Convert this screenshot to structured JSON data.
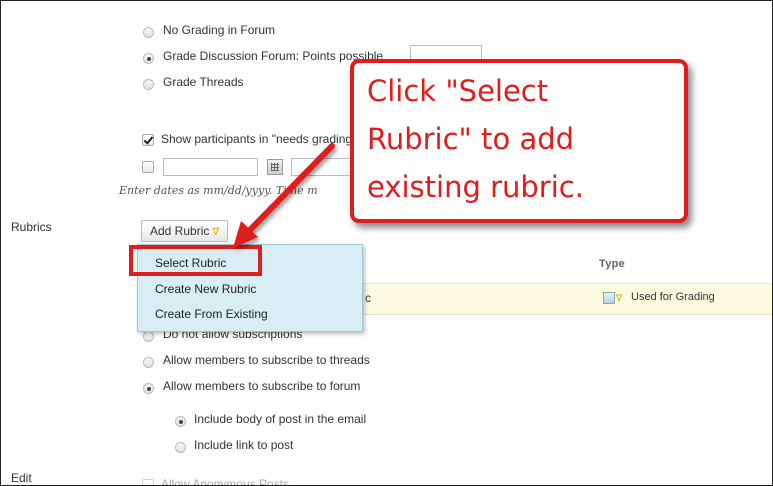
{
  "grading": {
    "options": [
      {
        "label": "No Grading in Forum",
        "selected": false
      },
      {
        "label": "Grade Discussion Forum: Points possible",
        "selected": true
      },
      {
        "label": "Grade Threads",
        "selected": false
      }
    ],
    "show_participants_label": "Show participants in \"needs grading\"",
    "date_hint": "Enter dates as mm/dd/yyyy. Time m"
  },
  "rubrics": {
    "section_label": "Rubrics",
    "add_button_label": "Add Rubric",
    "menu": [
      "Select Rubric",
      "Create New Rubric",
      "Create From Existing"
    ],
    "type_header": "Type",
    "row_type_value": "Used for Grading",
    "row_text_fragment": "c"
  },
  "subscriptions": {
    "options": [
      {
        "label": "Do not allow subscriptions",
        "selected": false
      },
      {
        "label": "Allow members to subscribe to threads",
        "selected": false
      },
      {
        "label": "Allow members to subscribe to forum",
        "selected": true
      }
    ],
    "sub_options": [
      {
        "label": "Include body of post in the email",
        "selected": true
      },
      {
        "label": "Include link to post",
        "selected": false
      }
    ]
  },
  "edit": {
    "section_label": "Edit",
    "anonymous_label": "Allow Anonymous Posts"
  },
  "callout": {
    "lines": [
      "Click \"Select",
      "Rubric\" to add",
      "existing rubric."
    ]
  },
  "colors": {
    "callout_red": "#e01c1c",
    "menu_bg": "#d9eef4",
    "row_yellow": "#fcfbe0"
  }
}
